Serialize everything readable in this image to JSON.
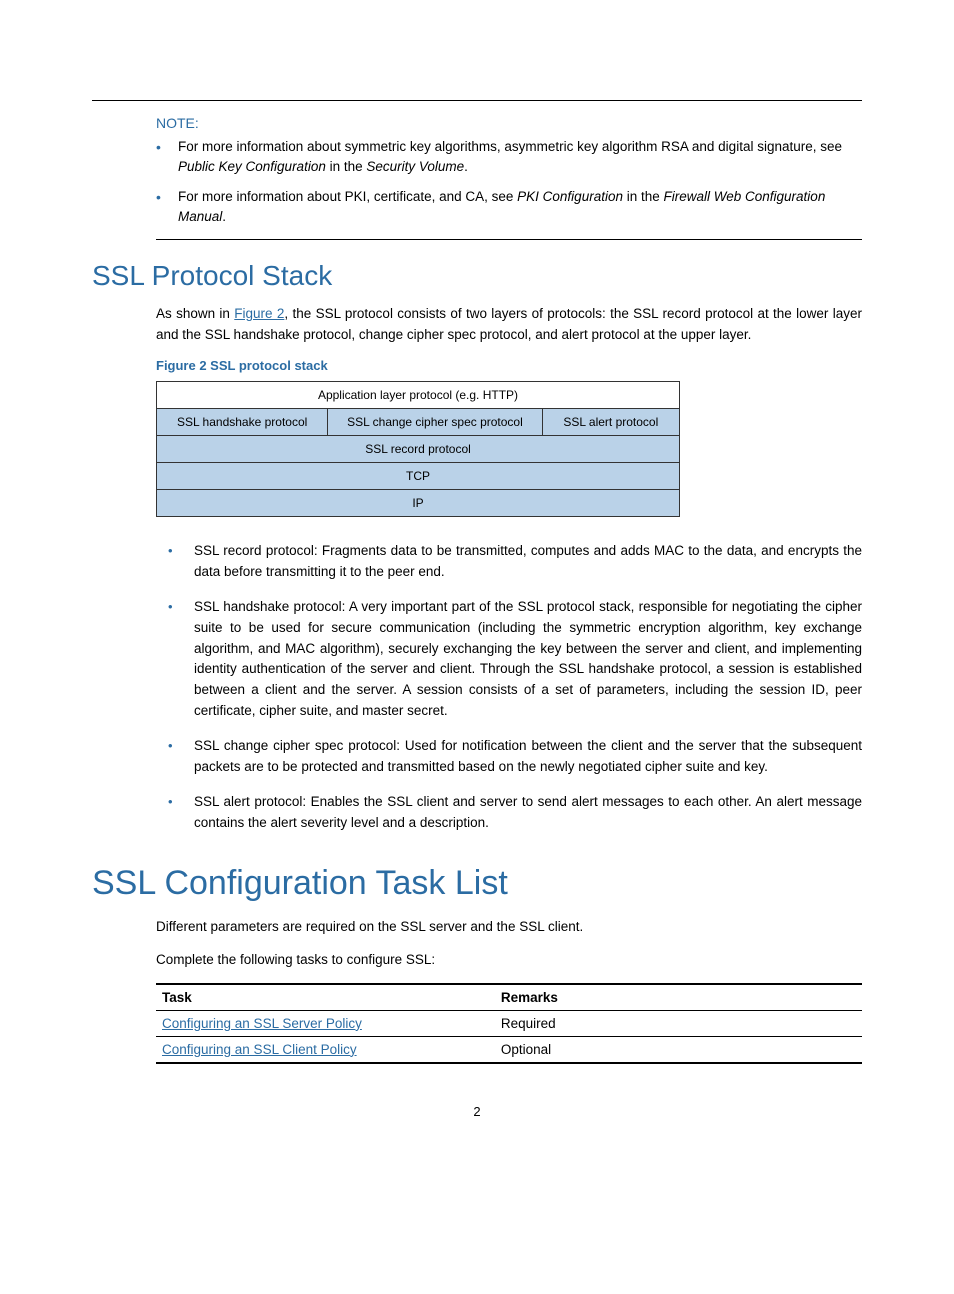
{
  "note": {
    "heading": "NOTE:",
    "items": [
      {
        "pre": "For more information about symmetric key algorithms, asymmetric key algorithm RSA and digital signature, see ",
        "ital1": "Public Key Configuration",
        "mid": " in the ",
        "ital2": "Security Volume",
        "post": "."
      },
      {
        "pre": "For more information about PKI, certificate, and CA, see ",
        "ital1": "PKI Configuration",
        "mid": " in the ",
        "ital2": "Firewall Web Configuration Manual",
        "post": "."
      }
    ]
  },
  "section1": {
    "title": "SSL Protocol Stack",
    "para_pre": "As shown in ",
    "para_link": "Figure 2",
    "para_post": ", the SSL protocol consists of two layers of protocols: the SSL record protocol at the lower layer and the SSL handshake protocol, change cipher spec protocol, and alert protocol at the upper layer.",
    "figure_caption": "Figure 2 SSL protocol stack",
    "stack": {
      "row1": "Application layer protocol (e.g. HTTP)",
      "row2a": "SSL handshake protocol",
      "row2b": "SSL change cipher spec protocol",
      "row2c": "SSL alert protocol",
      "row3": "SSL record protocol",
      "row4": "TCP",
      "row5": "IP"
    },
    "bullets": [
      "SSL record protocol: Fragments data to be transmitted, computes and adds MAC to the data, and encrypts the data before transmitting it to the peer end.",
      "SSL handshake protocol: A very important part of the SSL protocol stack, responsible for negotiating the cipher suite to be used for secure communication (including the symmetric encryption algorithm, key exchange algorithm, and MAC algorithm), securely exchanging the key between the server and client, and implementing identity authentication of the server and client. Through the SSL handshake protocol, a session is established between a client and the server. A session consists of a set of parameters, including the session ID, peer certificate, cipher suite, and master secret.",
      "SSL change cipher spec protocol: Used for notification between the client and the server that the subsequent packets are to be protected and transmitted based on the newly negotiated cipher suite and key.",
      "SSL alert protocol: Enables the SSL client and server to send alert messages to each other. An alert message contains the alert severity level and a description."
    ]
  },
  "section2": {
    "title": "SSL Configuration Task List",
    "para1": "Different parameters are required on the SSL server and the SSL client.",
    "para2": "Complete the following tasks to configure SSL:",
    "table": {
      "headers": [
        "Task",
        "Remarks"
      ],
      "rows": [
        {
          "task": "Configuring an SSL Server Policy",
          "remark": "Required"
        },
        {
          "task": "Configuring an SSL Client Policy",
          "remark": "Optional"
        }
      ]
    }
  },
  "page_number": "2"
}
